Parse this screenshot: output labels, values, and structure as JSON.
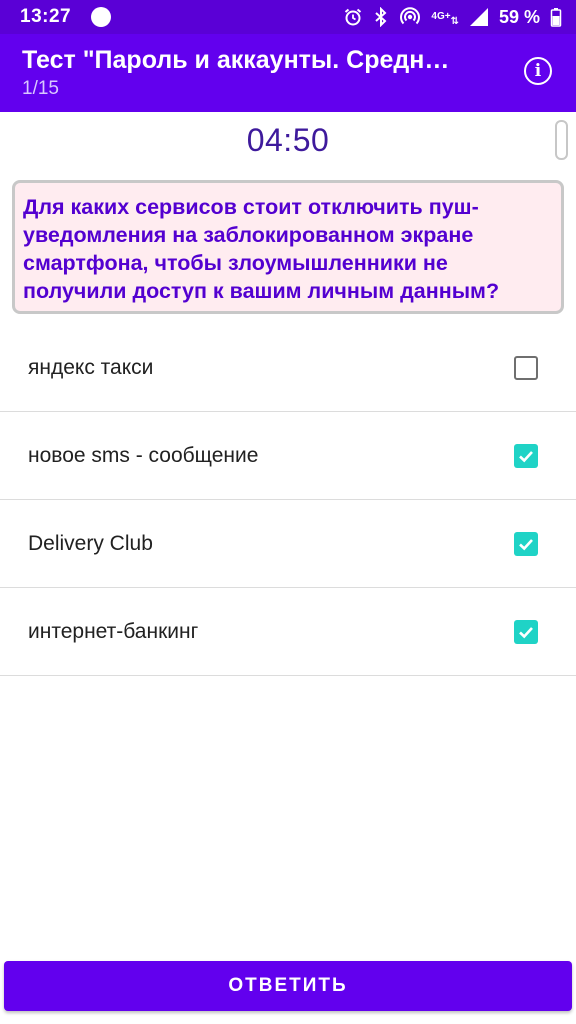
{
  "status_bar": {
    "time": "13:27",
    "battery_percent": "59 %",
    "icons": [
      "alarm-icon",
      "bluetooth-icon",
      "hotspot-icon",
      "network-4g-icon",
      "signal-icon",
      "battery-icon"
    ],
    "network_label": "4G+"
  },
  "app_bar": {
    "title": "Тест \"Пароль и аккаунты. Средн…",
    "subtitle": "1/15",
    "info_icon": "i"
  },
  "timer": "04:50",
  "question": "Для каких сервисов стоит отключить пуш-уведомления на заблокированном экране смартфона, чтобы злоумышленники не получили доступ к вашим личным данным?",
  "answers": [
    {
      "label": "яндекс такси",
      "checked": false
    },
    {
      "label": "новое sms - сообщение",
      "checked": true
    },
    {
      "label": "Delivery Club",
      "checked": true
    },
    {
      "label": "интернет-банкинг",
      "checked": true
    }
  ],
  "submit_label": "ОТВЕТИТЬ",
  "colors": {
    "primary": "#6200ee",
    "status_bar": "#5a00d6",
    "question_text": "#5300d0",
    "question_bg": "#ffecf0",
    "checkbox_checked": "#1fd3c6"
  }
}
